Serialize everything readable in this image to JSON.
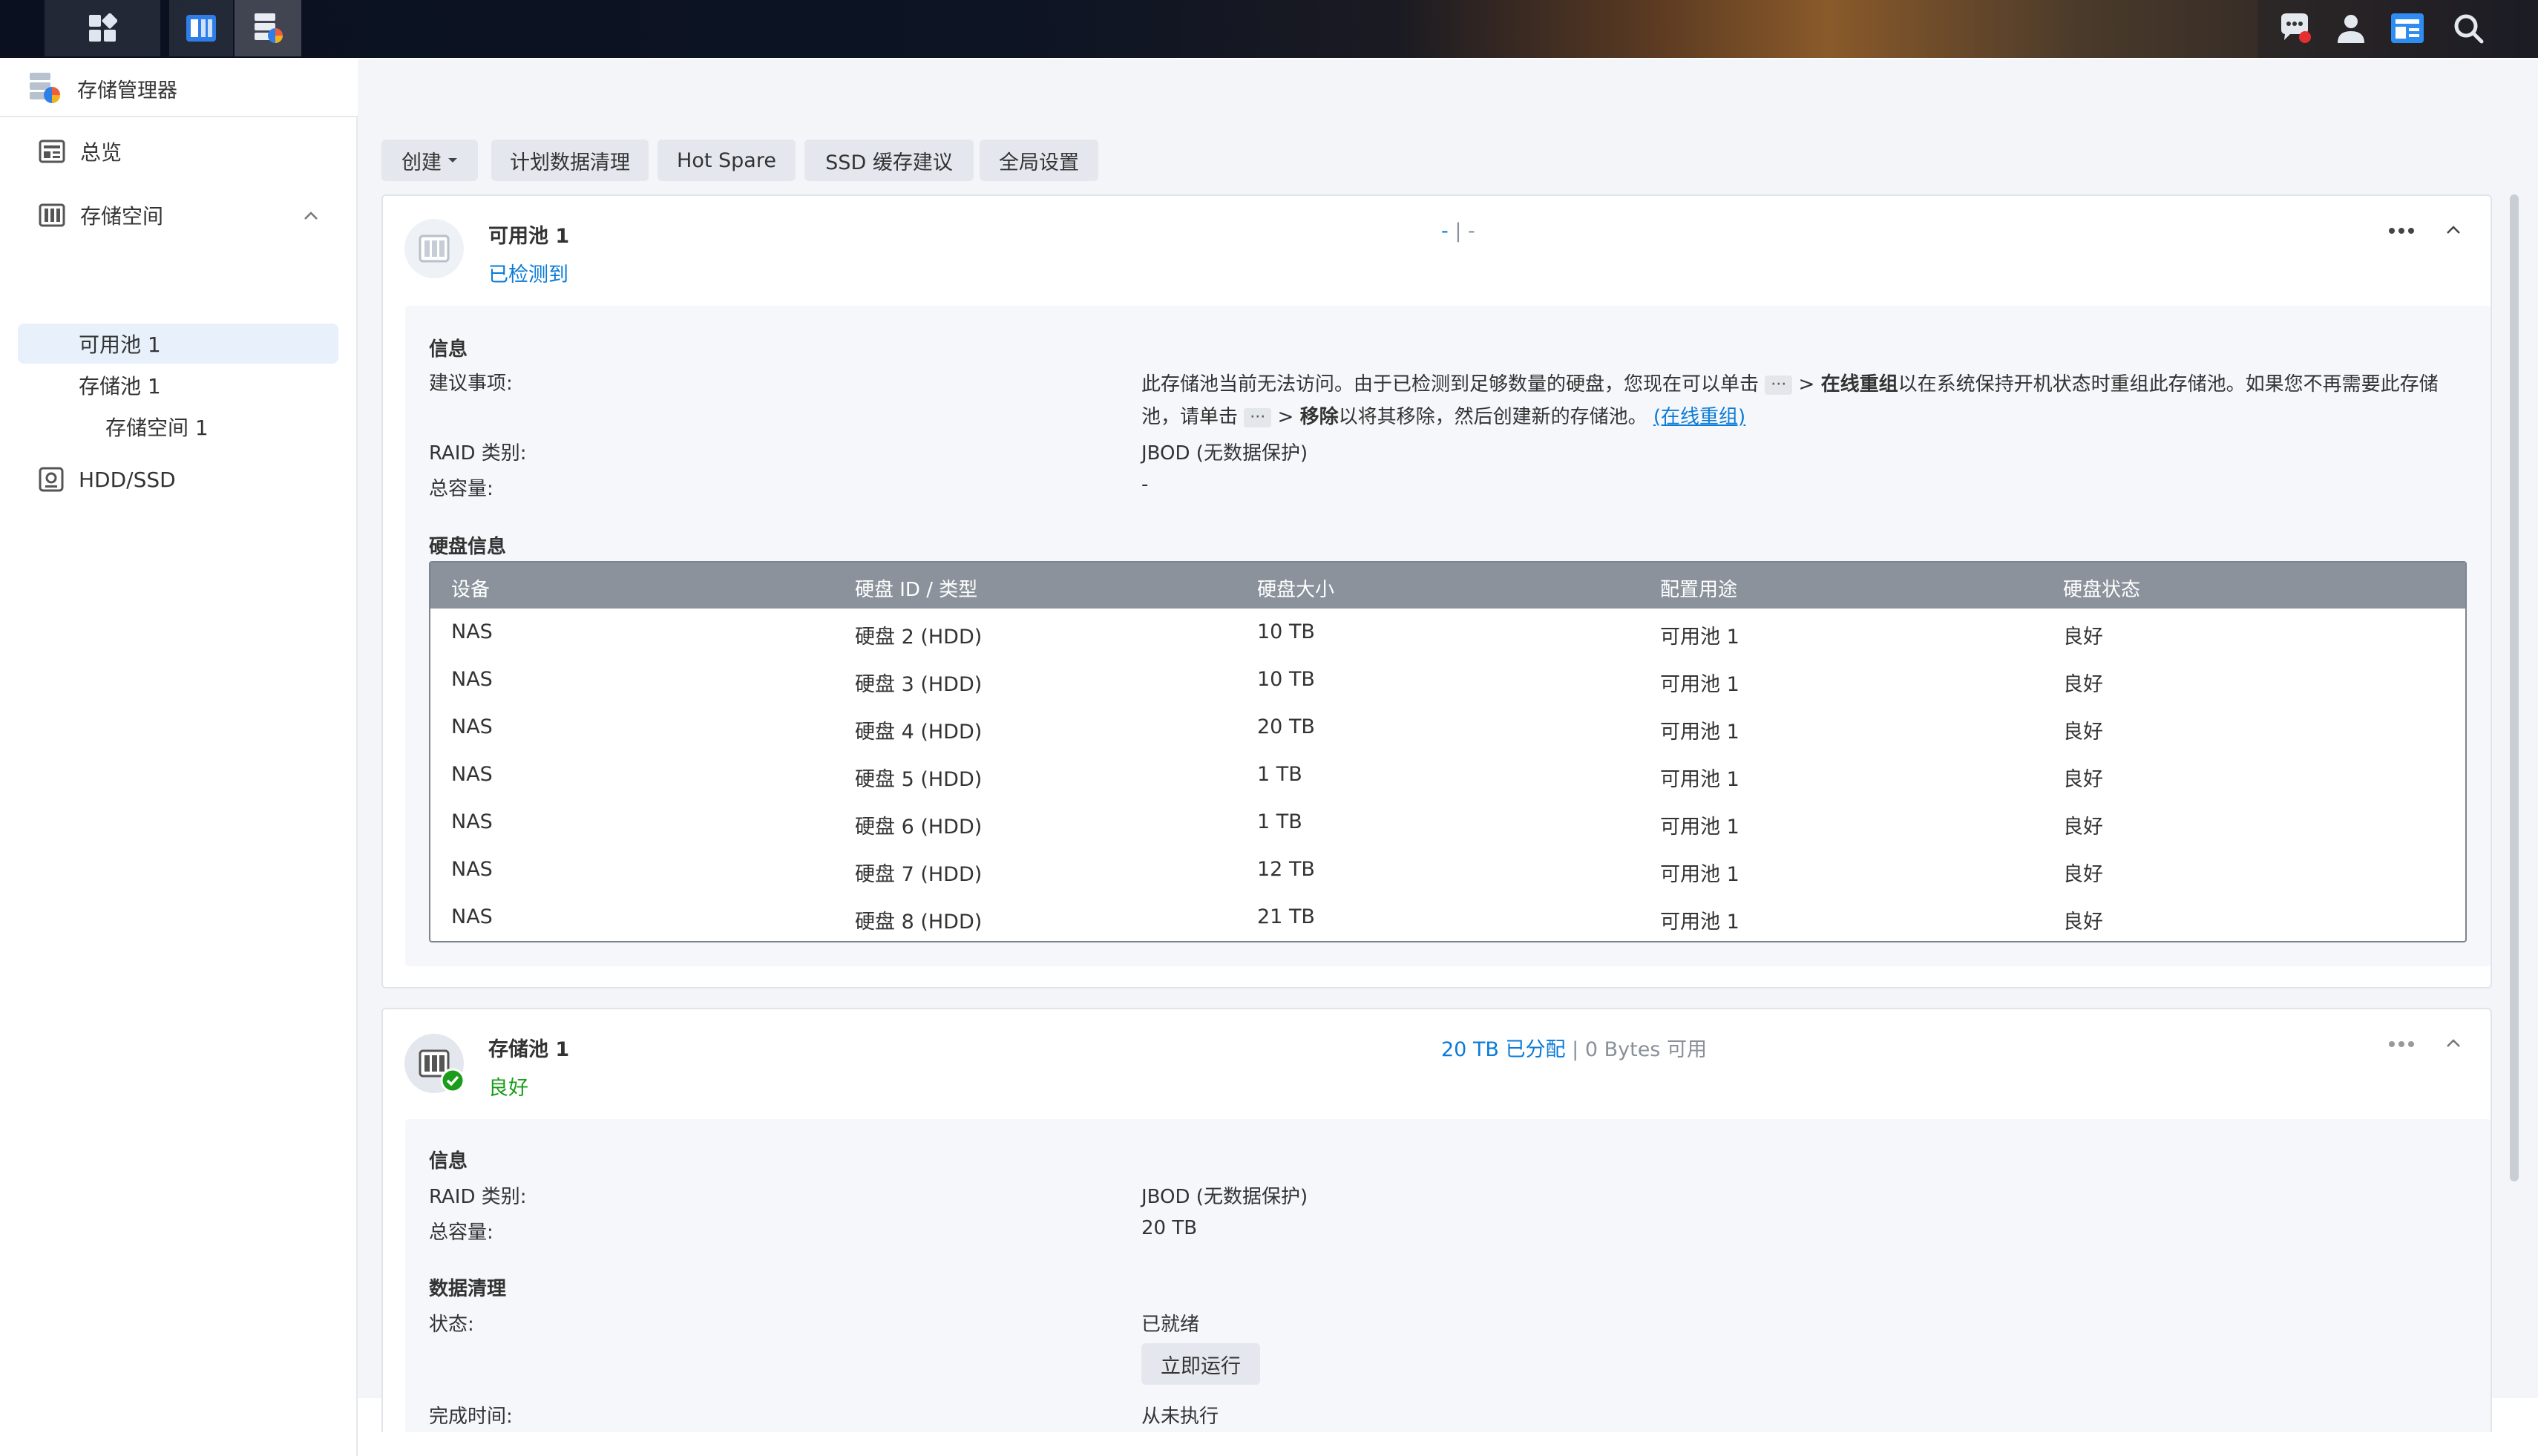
{
  "window": {
    "title": "存储管理器"
  },
  "sidebar": {
    "items": [
      {
        "label": "总览"
      },
      {
        "label": "存储空间"
      },
      {
        "label": "可用池 1"
      },
      {
        "label": "存储池 1"
      },
      {
        "label": "存储空间 1"
      },
      {
        "label": "HDD/SSD"
      }
    ]
  },
  "toolbar": {
    "create": "创建",
    "schedule": "计划数据清理",
    "hot_spare": "Hot Spare",
    "ssd_cache": "SSD 缓存建议",
    "global": "全局设置"
  },
  "pool_available": {
    "name": "可用池 1",
    "status": "已检测到",
    "summary_a": "-",
    "summary_sep": "|",
    "summary_b": "-",
    "info_heading": "信息",
    "advice_label": "建议事项:",
    "advice_1a": "此存储池当前无法访问。由于已检测到足够数量的硬盘，您现在可以单击",
    "advice_1b": "> ",
    "advice_1c": "在线重组",
    "advice_1d": "以在系统保持开机状态时重组此存储池。如果您不再需要此存储",
    "advice_2a": "池，请单击",
    "advice_2b": "> ",
    "advice_2c": "移除",
    "advice_2d": "以将其移除，然后创建新的存储池。",
    "advice_link": "(在线重组)",
    "ellipsis": "···",
    "raid_label": "RAID 类别:",
    "raid_value": "JBOD (无数据保护)",
    "capacity_label": "总容量:",
    "capacity_value": "-",
    "disk_heading": "硬盘信息",
    "table": {
      "headers": [
        "设备",
        "硬盘 ID / 类型",
        "硬盘大小",
        "配置用途",
        "硬盘状态"
      ],
      "rows": [
        [
          "NAS",
          "硬盘 2 (HDD)",
          "10 TB",
          "可用池 1",
          "良好"
        ],
        [
          "NAS",
          "硬盘 3 (HDD)",
          "10 TB",
          "可用池 1",
          "良好"
        ],
        [
          "NAS",
          "硬盘 4 (HDD)",
          "20 TB",
          "可用池 1",
          "良好"
        ],
        [
          "NAS",
          "硬盘 5 (HDD)",
          "1 TB",
          "可用池 1",
          "良好"
        ],
        [
          "NAS",
          "硬盘 6 (HDD)",
          "1 TB",
          "可用池 1",
          "良好"
        ],
        [
          "NAS",
          "硬盘 7 (HDD)",
          "12 TB",
          "可用池 1",
          "良好"
        ],
        [
          "NAS",
          "硬盘 8 (HDD)",
          "21 TB",
          "可用池 1",
          "良好"
        ]
      ]
    }
  },
  "pool_storage": {
    "name": "存储池 1",
    "status": "良好",
    "allocated": "20 TB 已分配",
    "sep": "|",
    "available": "0 Bytes 可用",
    "info_heading": "信息",
    "raid_label": "RAID 类别:",
    "raid_value": "JBOD (无数据保护)",
    "capacity_label": "总容量:",
    "capacity_value": "20 TB",
    "scrub_heading": "数据清理",
    "state_label": "状态:",
    "state_value": "已就绪",
    "run_now": "立即运行",
    "finish_label": "完成时间:",
    "finish_value": "从未执行"
  },
  "colors": {
    "accent": "#0a7bd6",
    "good": "#1b9c1b",
    "table_header": "#8b929c"
  }
}
